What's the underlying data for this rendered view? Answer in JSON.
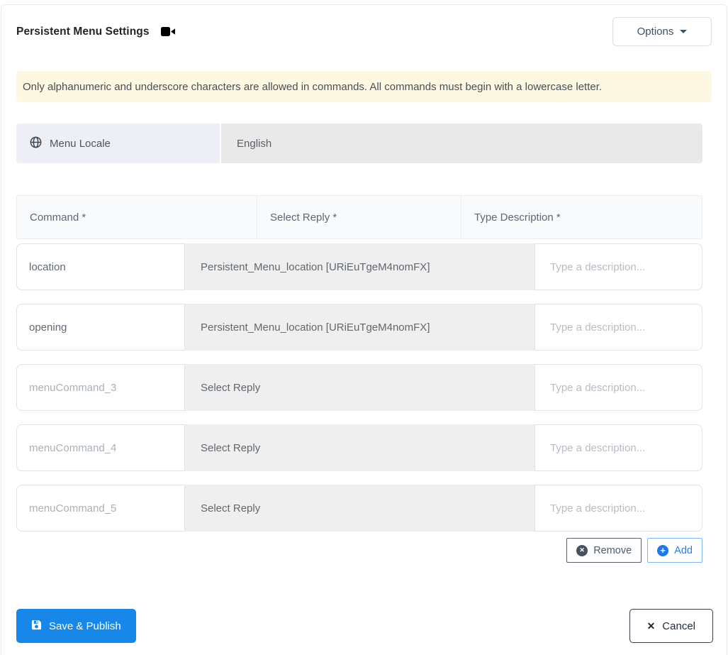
{
  "header": {
    "title": "Persistent Menu Settings",
    "options_label": "Options"
  },
  "alert": {
    "text": "Only alphanumeric and underscore characters are allowed in commands. All commands must begin with a lowercase letter."
  },
  "locale": {
    "label": "Menu Locale",
    "value": "English"
  },
  "table": {
    "columns": [
      "Command *",
      "Select Reply *",
      "Type Description *"
    ],
    "rows": [
      {
        "command_value": "location",
        "reply": "Persistent_Menu_location [URiEuTgeM4nomFX]",
        "description_placeholder": "Type a description..."
      },
      {
        "command_value": "opening",
        "reply": "Persistent_Menu_location [URiEuTgeM4nomFX]",
        "description_placeholder": "Type a description..."
      },
      {
        "command_placeholder": "menuCommand_3",
        "reply": "Select Reply",
        "description_placeholder": "Type a description..."
      },
      {
        "command_placeholder": "menuCommand_4",
        "reply": "Select Reply",
        "description_placeholder": "Type a description..."
      },
      {
        "command_placeholder": "menuCommand_5",
        "reply": "Select Reply",
        "description_placeholder": "Type a description..."
      }
    ]
  },
  "actions": {
    "remove_label": "Remove",
    "add_label": "Add"
  },
  "footer": {
    "save_label": "Save & Publish",
    "cancel_label": "Cancel"
  },
  "colors": {
    "primary_blue": "#1787e9",
    "add_blue": "#2e7ce4",
    "remove_icon_bg": "#47525f",
    "alert_bg": "#fdf8e2",
    "select_bg": "#efefef",
    "locale_label_bg": "#edeff4",
    "locale_value_bg": "#e9e9e9"
  }
}
